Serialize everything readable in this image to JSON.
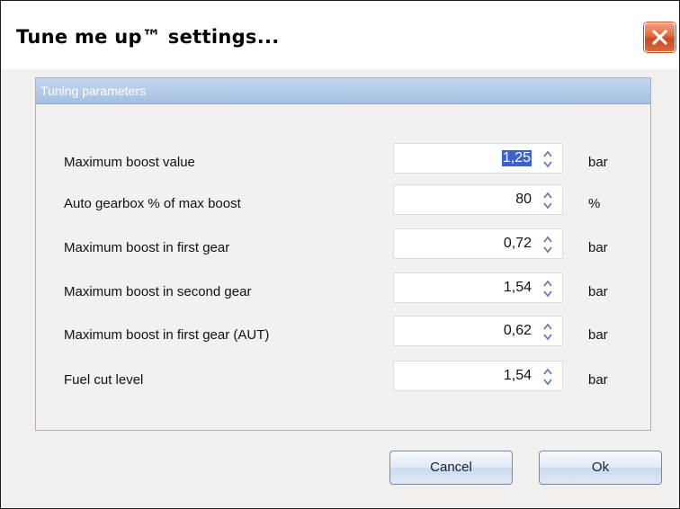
{
  "dialog": {
    "title": "Tune me up™ settings...",
    "group_title": "Tuning parameters",
    "parameters": [
      {
        "label": "Maximum boost value",
        "value": "1,25",
        "unit": "bar",
        "selected": true
      },
      {
        "label": "Auto gearbox % of max boost",
        "value": "80",
        "unit": "%"
      },
      {
        "label": "Maximum boost in first gear",
        "value": "0,72",
        "unit": "bar"
      },
      {
        "label": "Maximum boost in second gear",
        "value": "1,54",
        "unit": "bar"
      },
      {
        "label": "Maximum boost in first gear (AUT)",
        "value": "0,62",
        "unit": "bar"
      },
      {
        "label": "Fuel cut level",
        "value": "1,54",
        "unit": "bar"
      }
    ],
    "buttons": {
      "cancel": "Cancel",
      "ok": "Ok"
    }
  },
  "icons": {
    "close": "close-icon",
    "spin_up": "chevron-up-icon",
    "spin_down": "chevron-down-icon"
  },
  "colors": {
    "close_button": "#e3683c",
    "group_header": "#b3cae8",
    "selection": "#3b64c6"
  }
}
